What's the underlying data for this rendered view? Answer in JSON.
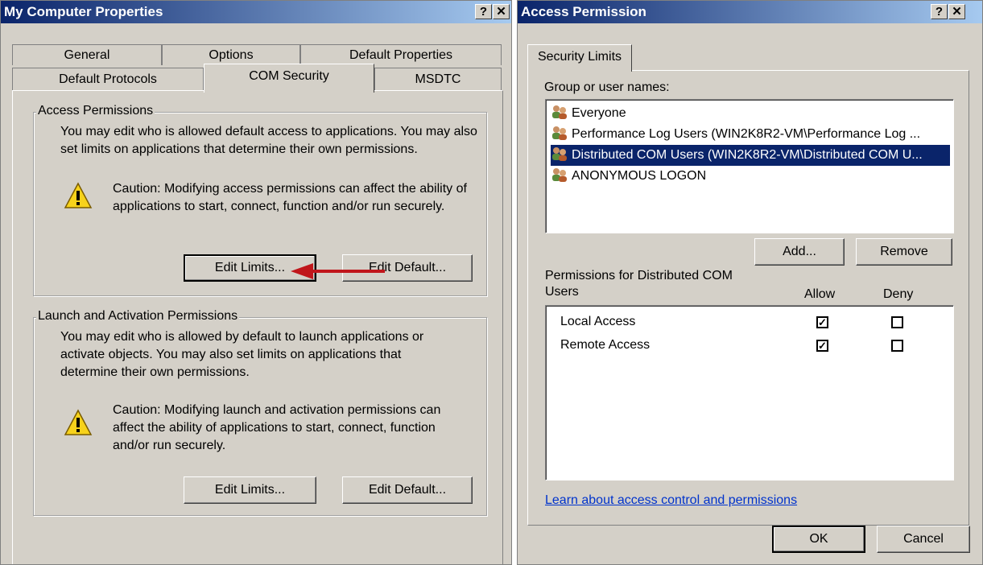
{
  "left_window": {
    "title": "My Computer Properties",
    "help_button": "?",
    "close_button": "✕",
    "tabs_row1": [
      "General",
      "Options",
      "Default Properties"
    ],
    "tabs_row2": [
      "Default Protocols",
      "COM Security",
      "MSDTC"
    ],
    "active_tab": "COM Security",
    "access_group": {
      "title": "Access Permissions",
      "description": "You may edit who is allowed default access to applications. You may also set limits on applications that determine their own permissions.",
      "caution": "Caution: Modifying access permissions can affect the ability of applications to start, connect, function and/or run securely.",
      "edit_limits": "Edit Limits...",
      "edit_default": "Edit Default..."
    },
    "launch_group": {
      "title": "Launch and Activation Permissions",
      "description": "You may edit who is allowed by default to launch applications or activate objects. You may also set limits on applications that determine their own permissions.",
      "caution": "Caution: Modifying launch and activation permissions can affect the ability of applications to start, connect, function and/or run securely.",
      "edit_limits": "Edit Limits...",
      "edit_default": "Edit Default..."
    },
    "annotation_arrow_color": "#c0161b"
  },
  "right_window": {
    "title": "Access Permission",
    "help_button": "?",
    "close_button": "✕",
    "tab": "Security Limits",
    "group_label": "Group or user names:",
    "users": [
      "Everyone",
      "Performance Log Users (WIN2K8R2-VM\\Performance Log ...",
      "Distributed COM Users (WIN2K8R2-VM\\Distributed COM U...",
      "ANONYMOUS LOGON"
    ],
    "selected_user": "Distributed COM Users (WIN2K8R2-VM\\Distributed COM U...",
    "add_button": "Add...",
    "remove_button": "Remove",
    "permissions_label_line1": "Permissions for Distributed COM",
    "permissions_label_line2": "Users",
    "allow_header": "Allow",
    "deny_header": "Deny",
    "permissions": [
      {
        "name": "Local Access",
        "allow": true,
        "deny": false
      },
      {
        "name": "Remote Access",
        "allow": true,
        "deny": false
      }
    ],
    "learn_link": "Learn about access control and permissions",
    "ok_button": "OK",
    "cancel_button": "Cancel"
  },
  "colors": {
    "dialog_bg": "#d4d0c8",
    "titlebar_start": "#0a246a",
    "titlebar_end": "#a6caf0",
    "selection": "#0a246a",
    "link": "#0033cc"
  }
}
